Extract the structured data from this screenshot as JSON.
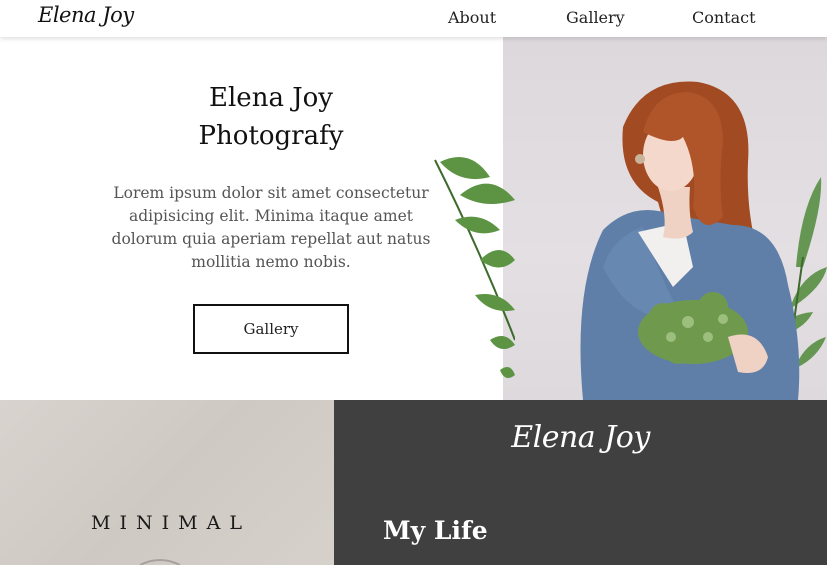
{
  "nav": {
    "logo": "Elena Joy",
    "links": [
      "About",
      "Gallery",
      "Contact"
    ]
  },
  "hero": {
    "title_line1": "Elena Joy",
    "title_line2": "Photografy",
    "text": "Lorem ipsum dolor sit amet consectetur adipisicing elit. Minima itaque amet dolorum quia aperiam repellat aut natus mollitia nemo nobis.",
    "button_label": "Gallery"
  },
  "minimal": {
    "text": "MINIMAL"
  },
  "dark_panel": {
    "logo": "Elena Joy",
    "title": "My Life"
  },
  "colors": {
    "dark_panel": "#404040",
    "nav_bg": "#ffffff",
    "photo_bg": "#dcd8dc"
  }
}
